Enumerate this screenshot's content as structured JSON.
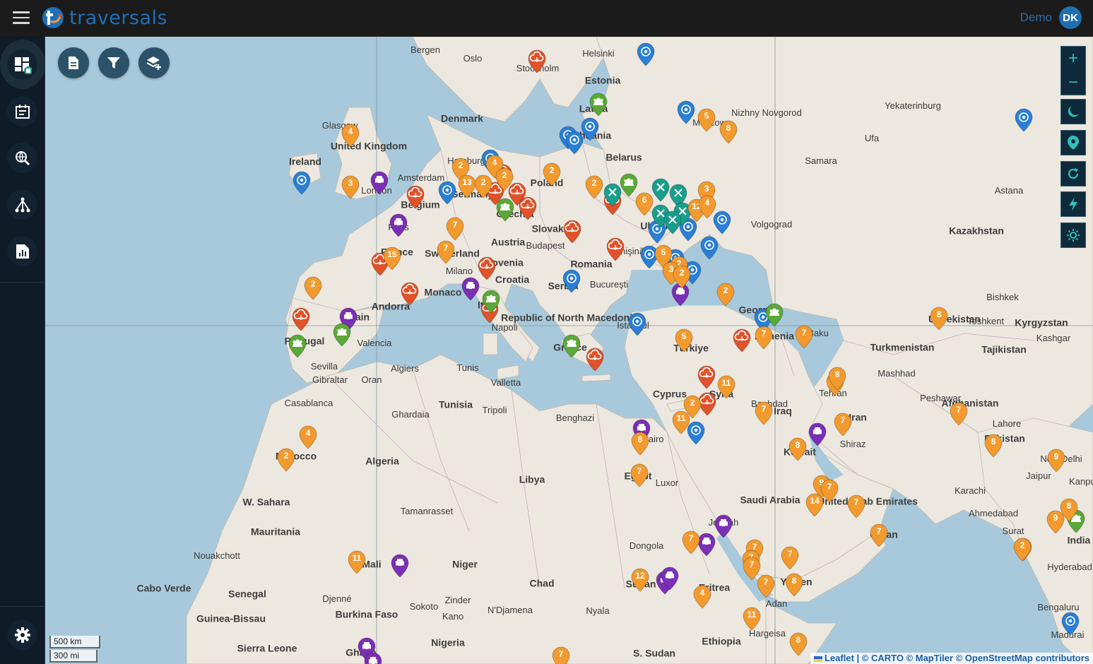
{
  "header": {
    "app_name": "traversals",
    "user_name": "Demo",
    "user_initials": "DK",
    "brand_color": "#1e6fb8"
  },
  "sidebar": {
    "items": [
      {
        "icon": "dashboard-map-icon",
        "active": true
      },
      {
        "icon": "calendar-list-icon",
        "active": false
      },
      {
        "icon": "search-globe-icon",
        "active": false
      },
      {
        "icon": "network-tree-icon",
        "active": false
      },
      {
        "icon": "report-chart-icon",
        "active": false
      }
    ],
    "settings_icon": "gear-icon"
  },
  "toolbar": {
    "buttons": [
      {
        "name": "document-icon"
      },
      {
        "name": "filter-icon"
      },
      {
        "name": "add-layer-icon"
      }
    ]
  },
  "map_controls": {
    "zoom_in": "+",
    "zoom_out": "−",
    "icons": [
      "moon-icon",
      "location-pin-icon",
      "refresh-icon",
      "lightning-icon",
      "sun-icon"
    ]
  },
  "scale": {
    "km": "500 km",
    "mi": "300 mi"
  },
  "attribution": {
    "leaflet": "Leaflet",
    "rest": " | © CARTO © MapTiler © OpenStreetMap contributors"
  },
  "map_labels": {
    "countries": [
      "United Kingdom",
      "Ireland",
      "Belgium",
      "Germany",
      "Poland",
      "Czechia",
      "Slovakia",
      "Austria",
      "Switzerland",
      "France",
      "Andorra",
      "Monaco",
      "Italy",
      "Slovenia",
      "Croatia",
      "Serbia",
      "Romania",
      "Ukraine",
      "Belarus",
      "Lithuania",
      "Latvia",
      "Estonia",
      "Denmark",
      "Republic of North Macedonia",
      "Greece",
      "Türkiye",
      "Cyprus",
      "Syria",
      "Armenia",
      "Georgia",
      "Portugal",
      "Spain",
      "Morocco",
      "Algeria",
      "Tunisia",
      "Libya",
      "Egypt",
      "W. Sahara",
      "Mauritania",
      "Mali",
      "Niger",
      "Chad",
      "Sudan",
      "S. Sudan",
      "Eritrea",
      "Ethiopia",
      "Yemen",
      "Oman",
      "Saudi Arabia",
      "United Arab Emirates",
      "Kuwait",
      "Iraq",
      "Iran",
      "Afghanistan",
      "Pakistan",
      "India",
      "Turkmenistan",
      "Uzbekistan",
      "Tajikistan",
      "Kyrgyzstan",
      "Kazakhstan",
      "Senegal",
      "Guinea-Bissau",
      "Sierra Leone",
      "Burkina Faso",
      "Nigeria",
      "Ghana",
      "Cabo Verde"
    ],
    "cities": [
      "Bergen",
      "Oslo",
      "Stockholm",
      "Helsinki",
      "Glasgow",
      "London",
      "Amsterdam",
      "Hamburg",
      "Paris",
      "Milano",
      "Budapest",
      "Bucureşti",
      "Chişinău",
      "Napoli",
      "İstanbul",
      "Moscow",
      "Nizhny Novgorod",
      "Yekaterinburg",
      "Samara",
      "Ufa",
      "Volgograd",
      "Astana",
      "Baku",
      "Tehran",
      "Baghdad",
      "Shiraz",
      "Mashhad",
      "Kashgar",
      "Toshkent",
      "Bishkek",
      "Peshawar",
      "Lahore",
      "New Delhi",
      "Jaipur",
      "Kanpur",
      "Karachi",
      "Ahmedabad",
      "Surat",
      "Hyderabad",
      "Bengaluru",
      "Madurai",
      "Valencia",
      "Sevilla",
      "Gibraltar",
      "Casablanca",
      "Algiers",
      "Oran",
      "Tunis",
      "Valletta",
      "Tripoli",
      "Benghazi",
      "Ghardaia",
      "Tamanrasset",
      "Cairo",
      "Luxor",
      "Jeddah",
      "Dongola",
      "Adan",
      "Hargeisa",
      "Nouakchott",
      "Djenné",
      "Sokoto",
      "Zinder",
      "N'Djamena",
      "Kano",
      "Nyala"
    ],
    "water": [
      "Cyprus"
    ]
  },
  "markers_legend": {
    "orange": "#f39a2e",
    "red": "#e0522a",
    "blue": "#2a7fd6",
    "purple": "#7b2fb5",
    "green": "#5ba838",
    "teal": "#1a9e8c"
  },
  "markers": [
    {
      "color": "orange",
      "label": "4"
    },
    {
      "color": "orange",
      "label": "3"
    },
    {
      "color": "orange",
      "label": "2"
    },
    {
      "color": "orange",
      "label": "13"
    },
    {
      "color": "orange",
      "label": "2"
    },
    {
      "color": "orange",
      "label": "4"
    },
    {
      "color": "orange",
      "label": "2"
    },
    {
      "color": "orange",
      "label": "2"
    },
    {
      "color": "orange",
      "label": "7"
    },
    {
      "color": "orange",
      "label": "7"
    },
    {
      "color": "orange",
      "label": "15"
    },
    {
      "color": "orange",
      "label": "2"
    },
    {
      "color": "orange",
      "label": "5"
    },
    {
      "color": "orange",
      "label": "8"
    },
    {
      "color": "orange",
      "label": "2"
    },
    {
      "color": "orange",
      "label": "6"
    },
    {
      "color": "orange",
      "label": "3"
    },
    {
      "color": "orange",
      "label": "12"
    },
    {
      "color": "orange",
      "label": "4"
    },
    {
      "color": "orange",
      "label": "5"
    },
    {
      "color": "orange",
      "label": "2"
    },
    {
      "color": "orange",
      "label": "3"
    },
    {
      "color": "orange",
      "label": "2"
    },
    {
      "color": "orange",
      "label": "5"
    },
    {
      "color": "orange",
      "label": "2"
    },
    {
      "color": "orange",
      "label": "11"
    },
    {
      "color": "orange",
      "label": "2"
    },
    {
      "color": "orange",
      "label": "11"
    },
    {
      "color": "orange",
      "label": "7"
    },
    {
      "color": "orange",
      "label": "9"
    },
    {
      "color": "orange",
      "label": "8"
    },
    {
      "color": "orange",
      "label": "7"
    },
    {
      "color": "orange",
      "label": "7"
    },
    {
      "color": "orange",
      "label": "8"
    },
    {
      "color": "orange",
      "label": "8"
    },
    {
      "color": "orange",
      "label": "7"
    },
    {
      "color": "orange",
      "label": "9"
    },
    {
      "color": "orange",
      "label": "7"
    },
    {
      "color": "orange",
      "label": "14"
    },
    {
      "color": "orange",
      "label": "7"
    },
    {
      "color": "orange",
      "label": "7"
    },
    {
      "color": "orange",
      "label": "7"
    },
    {
      "color": "orange",
      "label": "7"
    },
    {
      "color": "orange",
      "label": "7"
    },
    {
      "color": "orange",
      "label": "7"
    },
    {
      "color": "orange",
      "label": "7"
    },
    {
      "color": "orange",
      "label": "8"
    },
    {
      "color": "orange",
      "label": "12"
    },
    {
      "color": "orange",
      "label": "11"
    },
    {
      "color": "orange",
      "label": "4"
    },
    {
      "color": "orange",
      "label": "8"
    },
    {
      "color": "orange",
      "label": "7"
    },
    {
      "color": "orange",
      "label": "8"
    },
    {
      "color": "orange",
      "label": "9"
    },
    {
      "color": "orange",
      "label": "9"
    },
    {
      "color": "orange",
      "label": "8"
    },
    {
      "color": "orange",
      "label": "2"
    },
    {
      "color": "orange",
      "label": "4"
    },
    {
      "color": "orange",
      "label": "2"
    },
    {
      "color": "orange",
      "label": "11"
    },
    {
      "color": "orange",
      "label": "8"
    },
    {
      "color": "orange",
      "label": "7"
    },
    {
      "color": "orange",
      "label": "2"
    },
    {
      "color": "orange",
      "label": "7"
    },
    {
      "color": "orange",
      "label": "7"
    }
  ]
}
